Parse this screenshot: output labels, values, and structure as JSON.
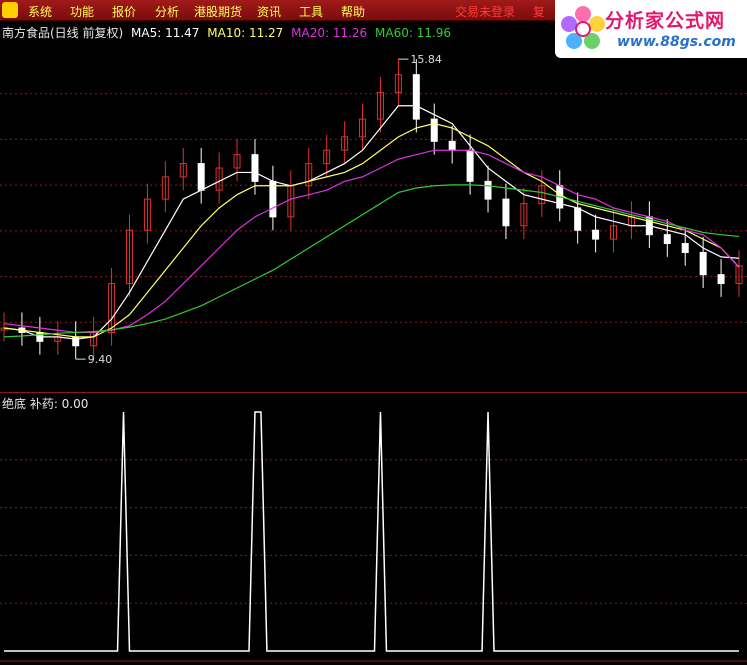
{
  "menu": {
    "items": [
      "系统",
      "功能",
      "报价",
      "分析",
      "港股期货",
      "资讯",
      "工具",
      "帮助"
    ],
    "right_items": [
      "交易未登录",
      "复"
    ]
  },
  "logo": {
    "title": "分析家公式网",
    "url": "www.88gs.com"
  },
  "main_panel": {
    "legend": {
      "stock": "南方食品(日线 前复权)",
      "ma5": "MA5: 11.47",
      "ma10": "MA10: 11.27",
      "ma20": "MA20: 11.26",
      "ma60": "MA60: 11.96"
    },
    "high_label": "15.84",
    "low_label": "9.40"
  },
  "sub_panel": {
    "legend": "绝底 补药: 0.00"
  },
  "colors": {
    "up": "#e03030",
    "down": "#ffffff",
    "ma5": "#ffffff",
    "ma10": "#ffff66",
    "ma20": "#dd33dd",
    "ma60": "#33cc33",
    "grid": "#8a1a1a"
  },
  "chart_data": [
    {
      "type": "line",
      "title": "南方食品(日线 前复权)",
      "x": [
        0,
        6,
        12,
        18,
        24,
        30,
        36,
        42,
        48,
        54,
        60,
        66,
        72,
        78,
        84,
        90,
        96,
        102,
        108,
        114,
        120,
        126,
        132,
        138,
        144,
        150,
        156,
        162,
        168,
        174,
        180,
        186,
        192,
        198,
        204,
        210,
        216,
        222,
        228,
        234,
        240,
        246
      ],
      "series": [
        {
          "name": "Close",
          "values": [
            9.9,
            9.8,
            9.6,
            9.7,
            9.5,
            9.8,
            10.9,
            12.1,
            12.8,
            13.3,
            13.6,
            13.0,
            13.5,
            13.8,
            13.2,
            12.4,
            13.1,
            13.6,
            13.9,
            14.2,
            14.6,
            15.2,
            15.6,
            14.6,
            14.1,
            13.9,
            13.2,
            12.8,
            12.2,
            12.7,
            13.1,
            12.6,
            12.1,
            11.9,
            12.2,
            12.4,
            12.0,
            11.8,
            11.6,
            11.1,
            10.9,
            11.3
          ]
        },
        {
          "name": "MA5",
          "values": [
            9.9,
            9.85,
            9.7,
            9.7,
            9.65,
            9.7,
            10.1,
            10.7,
            11.4,
            12.1,
            12.8,
            13.0,
            13.2,
            13.4,
            13.4,
            13.2,
            13.1,
            13.2,
            13.4,
            13.6,
            13.9,
            14.4,
            14.9,
            14.9,
            14.7,
            14.5,
            14.0,
            13.5,
            13.2,
            12.9,
            12.8,
            12.7,
            12.6,
            12.4,
            12.3,
            12.2,
            12.2,
            12.1,
            12.0,
            11.7,
            11.5,
            11.47
          ]
        },
        {
          "name": "MA10",
          "values": [
            9.9,
            9.85,
            9.8,
            9.75,
            9.7,
            9.7,
            9.9,
            10.2,
            10.7,
            11.2,
            11.7,
            12.2,
            12.6,
            12.9,
            13.1,
            13.1,
            13.1,
            13.2,
            13.3,
            13.4,
            13.6,
            13.9,
            14.2,
            14.4,
            14.5,
            14.4,
            14.2,
            14.0,
            13.7,
            13.4,
            13.2,
            12.9,
            12.7,
            12.6,
            12.5,
            12.4,
            12.3,
            12.2,
            12.1,
            11.9,
            11.7,
            11.27
          ]
        },
        {
          "name": "MA20",
          "values": [
            10.0,
            9.95,
            9.9,
            9.85,
            9.8,
            9.8,
            9.85,
            9.95,
            10.2,
            10.5,
            10.9,
            11.3,
            11.7,
            12.1,
            12.4,
            12.6,
            12.8,
            12.9,
            13.0,
            13.2,
            13.3,
            13.5,
            13.7,
            13.8,
            13.9,
            13.9,
            13.9,
            13.8,
            13.6,
            13.4,
            13.3,
            13.1,
            12.9,
            12.8,
            12.6,
            12.5,
            12.4,
            12.3,
            12.1,
            12.0,
            11.7,
            11.26
          ]
        },
        {
          "name": "MA60",
          "values": [
            9.7,
            9.72,
            9.75,
            9.78,
            9.8,
            9.82,
            9.86,
            9.92,
            10.0,
            10.1,
            10.25,
            10.4,
            10.6,
            10.8,
            11.0,
            11.2,
            11.45,
            11.7,
            11.95,
            12.2,
            12.45,
            12.7,
            12.95,
            13.05,
            13.1,
            13.12,
            13.12,
            13.1,
            13.05,
            13.0,
            12.95,
            12.85,
            12.75,
            12.65,
            12.55,
            12.45,
            12.35,
            12.25,
            12.15,
            12.05,
            12.0,
            11.96
          ]
        }
      ],
      "ylim": [
        9.0,
        16.2
      ]
    },
    {
      "type": "line",
      "title": "绝底 补药",
      "x": [
        0,
        10,
        20,
        30,
        38,
        40,
        42,
        50,
        60,
        80,
        82,
        84,
        86,
        88,
        100,
        120,
        124,
        126,
        128,
        132,
        150,
        160,
        162,
        164,
        166,
        200,
        246
      ],
      "series": [
        {
          "name": "绝底 补药",
          "values": [
            0,
            0,
            0,
            0,
            0,
            1,
            0,
            0,
            0,
            0,
            0,
            1,
            1,
            0,
            0,
            0,
            0,
            1,
            0,
            0,
            0,
            0,
            1,
            0,
            0,
            0,
            0
          ]
        }
      ],
      "ylim": [
        0,
        1
      ]
    }
  ]
}
